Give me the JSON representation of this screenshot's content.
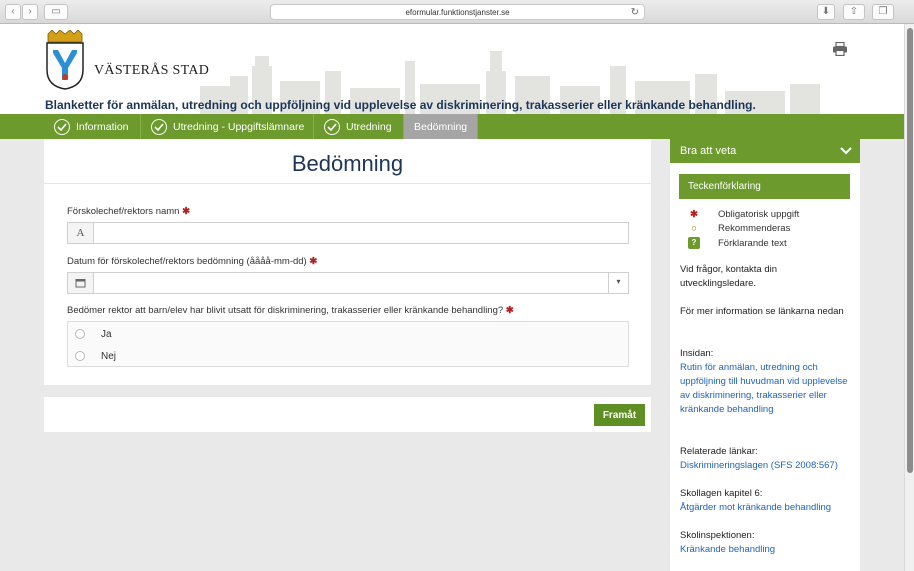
{
  "browser": {
    "url": "eformular.funktionstjanster.se"
  },
  "header": {
    "brand": "VÄSTERÅS STAD",
    "title": "Blanketter för anmälan, utredning och uppföljning vid upplevelse av diskriminering, trakasserier eller kränkande behandling."
  },
  "nav": {
    "tabs": [
      {
        "label": "Information"
      },
      {
        "label": "Utredning - Uppgiftslämnare"
      },
      {
        "label": "Utredning"
      },
      {
        "label": "Bedömning"
      }
    ]
  },
  "form": {
    "title": "Bedömning",
    "required_mark": "✱",
    "fields": [
      {
        "label": "Förskolechef/rektors namn",
        "value": "",
        "addon": "A"
      },
      {
        "label": "Datum för förskolechef/rektors bedömning (åååå-mm-dd)",
        "value": ""
      },
      {
        "label": "Bedömer rektor att barn/elev har blivit utsatt för diskriminering, trakasserier eller kränkande behandling?",
        "options": [
          "Ja",
          "Nej"
        ]
      }
    ],
    "next_label": "Framåt"
  },
  "sidebar": {
    "heading": "Bra att veta",
    "legend_heading": "Teckenförklaring",
    "legend": [
      {
        "symbol": "✱",
        "text": "Obligatorisk uppgift",
        "color": "#b22222"
      },
      {
        "symbol": "○",
        "text": "Rekommenderas",
        "color": "#8a6d00"
      },
      {
        "symbol": "?",
        "text": "Förklarande text",
        "color": "#6d9a2c"
      }
    ],
    "contact": "Vid frågor, kontakta din utvecklingsledare.",
    "more_info": "För mer information se länkarna nedan",
    "sections": [
      {
        "heading": "Insidan:",
        "link": "Rutin för anmälan, utredning och uppföljning till huvudman vid upplevelse av diskriminering, trakasserier eller kränkande behandling"
      },
      {
        "heading": "Relaterade länkar:",
        "link": "Diskrimineringslagen (SFS 2008:567)"
      },
      {
        "heading": "Skollagen kapitel 6:",
        "link": "Åtgärder mot kränkande behandling"
      },
      {
        "heading": "Skolinspektionen:",
        "link": "Kränkande behandling"
      }
    ]
  }
}
